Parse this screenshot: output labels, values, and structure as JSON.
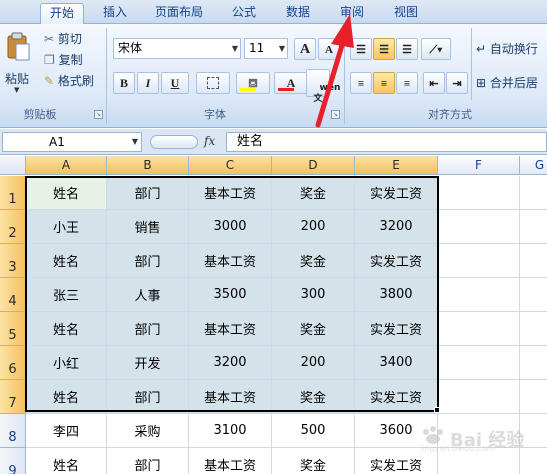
{
  "tabs": [
    {
      "label": "开始"
    },
    {
      "label": "插入"
    },
    {
      "label": "页面布局"
    },
    {
      "label": "公式"
    },
    {
      "label": "数据"
    },
    {
      "label": "审阅"
    },
    {
      "label": "视图"
    }
  ],
  "ribbon": {
    "clipboard": {
      "paste": "粘贴",
      "cut": "剪切",
      "copy": "复制",
      "format_painter": "格式刷",
      "label": "剪贴板"
    },
    "font": {
      "font_name": "宋体",
      "font_size": "11",
      "grow": "A",
      "shrink": "A",
      "bold": "B",
      "italic": "I",
      "underline": "U",
      "font_color_glyph": "A",
      "phonetic": "wén\n文",
      "label": "字体"
    },
    "alignment": {
      "wrap_text": "自动换行",
      "merge_center": "合并后居",
      "label": "对齐方式"
    }
  },
  "formula_bar": {
    "name_box": "A1",
    "fx": "fx",
    "content": "姓名"
  },
  "grid": {
    "columns": [
      "A",
      "B",
      "C",
      "D",
      "E",
      "F",
      "G"
    ],
    "rows": [
      {
        "num": "1",
        "cells": [
          "姓名",
          "部门",
          "基本工资",
          "奖金",
          "实发工资"
        ]
      },
      {
        "num": "2",
        "cells": [
          "小王",
          "销售",
          "3000",
          "200",
          "3200"
        ]
      },
      {
        "num": "3",
        "cells": [
          "姓名",
          "部门",
          "基本工资",
          "奖金",
          "实发工资"
        ]
      },
      {
        "num": "4",
        "cells": [
          "张三",
          "人事",
          "3500",
          "300",
          "3800"
        ]
      },
      {
        "num": "5",
        "cells": [
          "姓名",
          "部门",
          "基本工资",
          "奖金",
          "实发工资"
        ]
      },
      {
        "num": "6",
        "cells": [
          "小红",
          "开发",
          "3200",
          "200",
          "3400"
        ]
      },
      {
        "num": "7",
        "cells": [
          "姓名",
          "部门",
          "基本工资",
          "奖金",
          "实发工资"
        ]
      },
      {
        "num": "8",
        "cells": [
          "李四",
          "采购",
          "3100",
          "500",
          "3600"
        ]
      },
      {
        "num": "9",
        "cells": [
          "姓名",
          "部门",
          "基本工资",
          "奖金",
          "实发工资"
        ]
      }
    ]
  },
  "watermark": {
    "text": "Bai 经验",
    "sub": "jingyan.baidu.com"
  },
  "colors": {
    "selection_fill": "#d4e3ea",
    "header_selected": "#f4c060",
    "arrow": "#e8202a"
  }
}
